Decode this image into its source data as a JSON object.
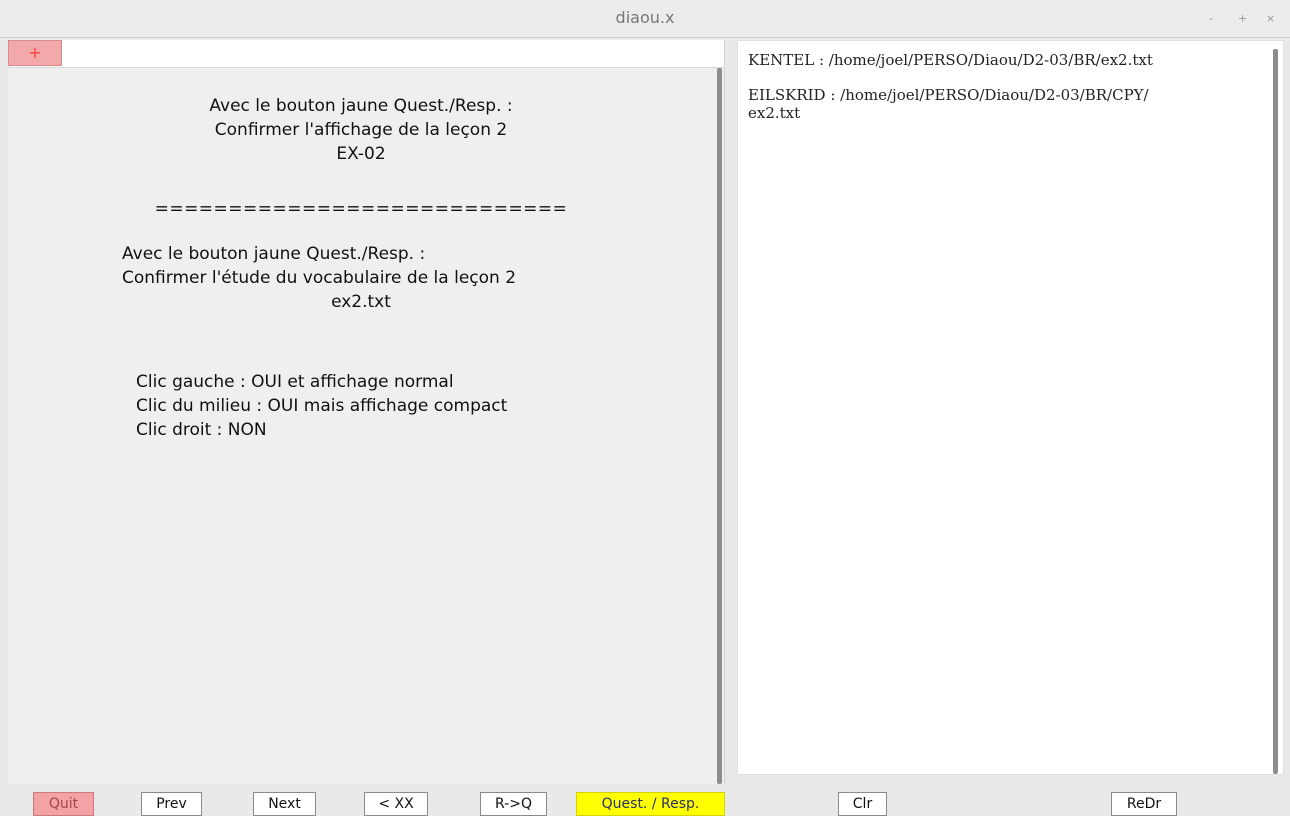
{
  "app": {
    "title": "diaou.x",
    "window_controls": [
      "-",
      "+",
      "×"
    ],
    "plus_tab": "+"
  },
  "left": {
    "block1": {
      "line1": "Avec le bouton jaune Quest./Resp. :",
      "line2": "Confirmer l'affichage de la leçon 2",
      "line3": "EX-02"
    },
    "separator": "============================",
    "block2": {
      "line1": "Avec le bouton jaune Quest./Resp. :",
      "line2": "Confirmer l'étude du vocabulaire de la leçon 2",
      "line3": "ex2.txt"
    },
    "block3": {
      "line1": "Clic gauche : OUI et affichage normal",
      "line2": "Clic du milieu : OUI mais affichage compact",
      "line3": "Clic droit : NON"
    }
  },
  "right": {
    "line1": "KENTEL : /home/joel/PERSO/Diaou/D2-03/BR/ex2.txt",
    "line2": "EILSKRID : /home/joel/PERSO/Diaou/D2-03/BR/CPY/",
    "line3": "ex2.txt"
  },
  "buttons": {
    "quit": "Quit",
    "prev": "Prev",
    "next": "Next",
    "back_xx": "< XX",
    "r_to_q": "R->Q",
    "quest_resp": "Quest. / Resp.",
    "clr": "Clr",
    "redr": "ReDr"
  },
  "colors": {
    "quit_button": "#f3a3a3",
    "quest_button": "#ffff00",
    "plus_tab": "#f3a9a9"
  }
}
